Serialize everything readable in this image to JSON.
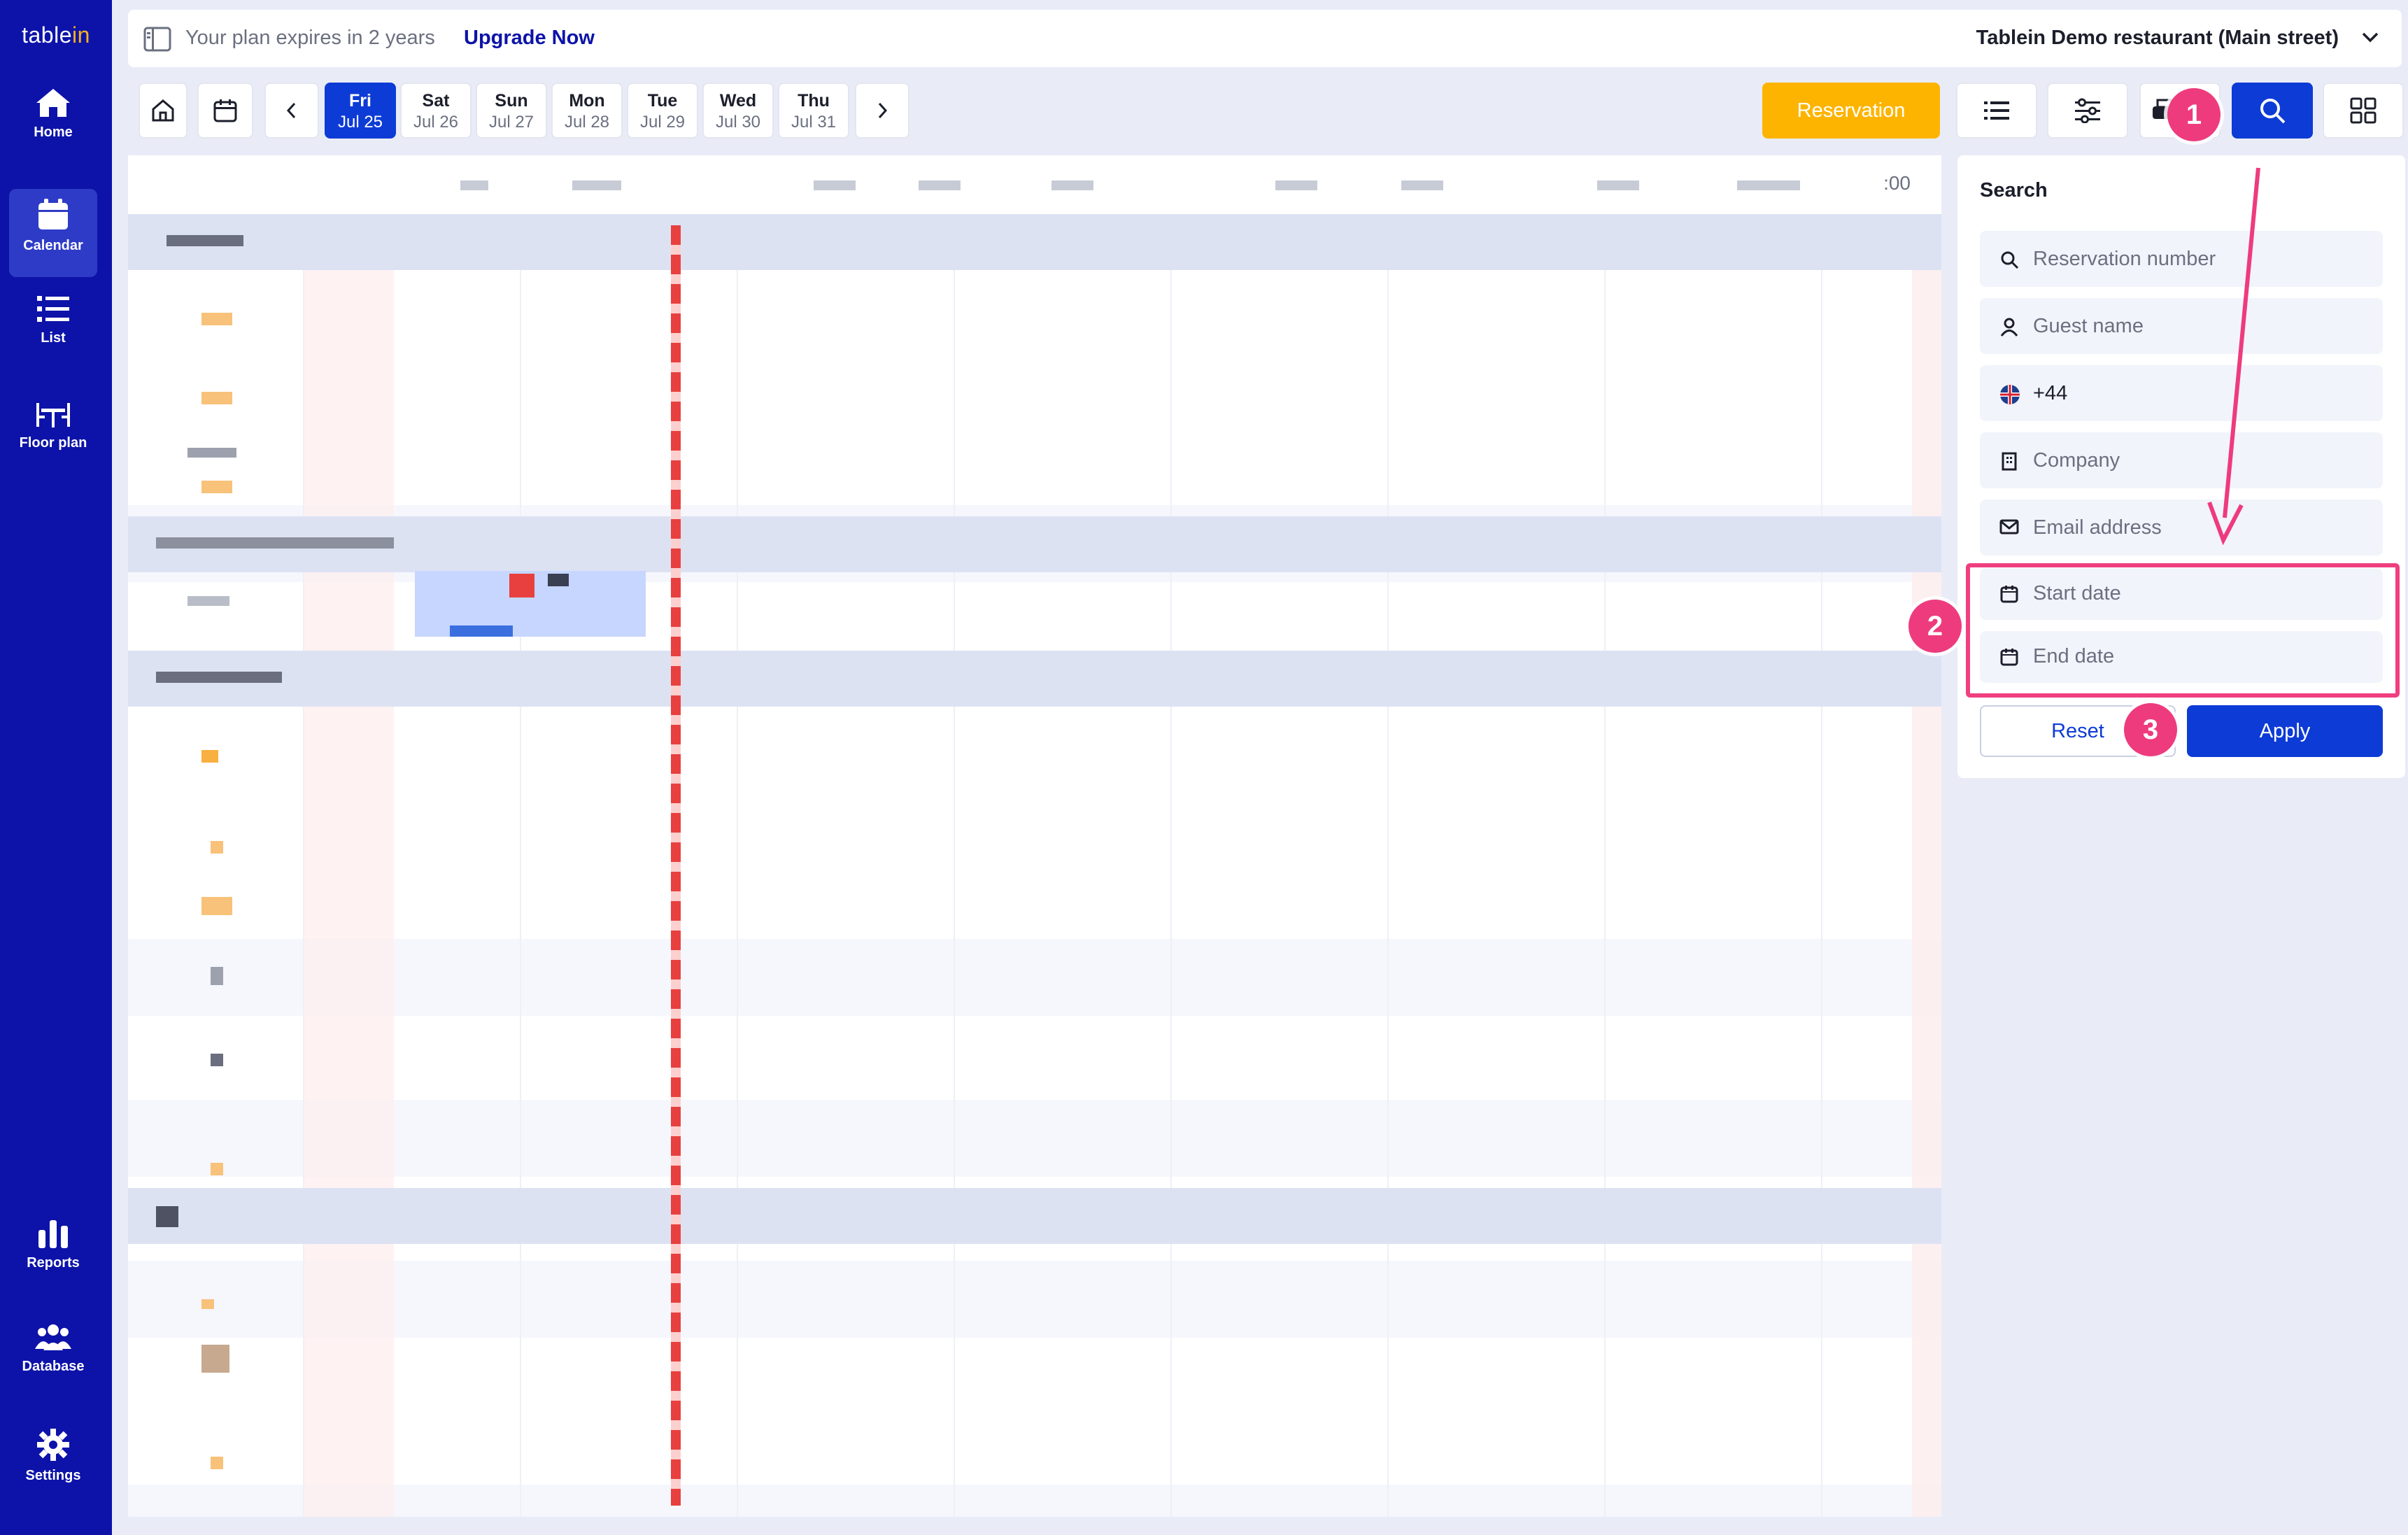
{
  "app": {
    "logo_main": "table",
    "logo_accent": "in"
  },
  "sidebar": {
    "items": [
      {
        "label": "Home",
        "icon": "home-icon"
      },
      {
        "label": "Calendar",
        "icon": "calendar-icon",
        "active": true
      },
      {
        "label": "List",
        "icon": "list-icon"
      },
      {
        "label": "Floor plan",
        "icon": "floor-plan-icon"
      },
      {
        "label": "Reports",
        "icon": "reports-icon"
      },
      {
        "label": "Database",
        "icon": "database-icon"
      },
      {
        "label": "Settings",
        "icon": "settings-icon"
      }
    ]
  },
  "topbar": {
    "plan_text": "Your plan expires in 2 years",
    "upgrade_label": "Upgrade Now",
    "restaurant_name": "Tablein Demo restaurant (Main street)"
  },
  "toolbar": {
    "days": [
      {
        "name": "Fri",
        "date": "Jul 25",
        "active": true
      },
      {
        "name": "Sat",
        "date": "Jul 26"
      },
      {
        "name": "Sun",
        "date": "Jul 27"
      },
      {
        "name": "Mon",
        "date": "Jul 28"
      },
      {
        "name": "Tue",
        "date": "Jul 29"
      },
      {
        "name": "Wed",
        "date": "Jul 30"
      },
      {
        "name": "Thu",
        "date": "Jul 31"
      }
    ],
    "reservation_label": "Reservation"
  },
  "timeline": {
    "time_end_label": ":00"
  },
  "search": {
    "title": "Search",
    "fields": [
      {
        "placeholder": "Reservation number",
        "icon": "search-icon"
      },
      {
        "placeholder": "Guest name",
        "icon": "person-icon"
      },
      {
        "value": "+44",
        "icon": "uk-flag-icon"
      },
      {
        "placeholder": "Company",
        "icon": "building-icon"
      },
      {
        "placeholder": "Email address",
        "icon": "envelope-icon"
      },
      {
        "placeholder": "Start date",
        "icon": "calendar-icon"
      },
      {
        "placeholder": "End date",
        "icon": "calendar-icon"
      }
    ],
    "reset_label": "Reset",
    "apply_label": "Apply"
  },
  "annotations": {
    "step1": "1",
    "step2": "2",
    "step3": "3"
  },
  "colors": {
    "sidebar": "#0d13a8",
    "primary": "#0d3bd6",
    "reservation": "#fdb400",
    "annotation": "#ee3b7e",
    "now_line": "#e8403e"
  }
}
